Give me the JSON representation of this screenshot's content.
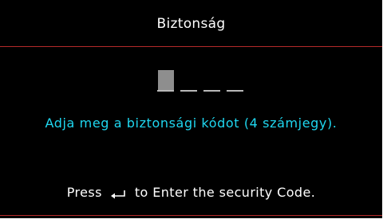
{
  "title": "Biztonság",
  "code": {
    "digits": 4,
    "filled": 1
  },
  "prompt": "Adja meg a biztonsági kódot (4 számjegy).",
  "hint": {
    "before_icon": "Press",
    "icon": "enter-arrow-icon",
    "after_icon": "to Enter the security Code."
  },
  "colors": {
    "background": "#000000",
    "divider": "#b42a2a",
    "title_text": "#ffffff",
    "prompt_text": "#1fd7f0",
    "slot_fill": "#8e8e8e",
    "slot_underline": "#b9b9b9"
  }
}
